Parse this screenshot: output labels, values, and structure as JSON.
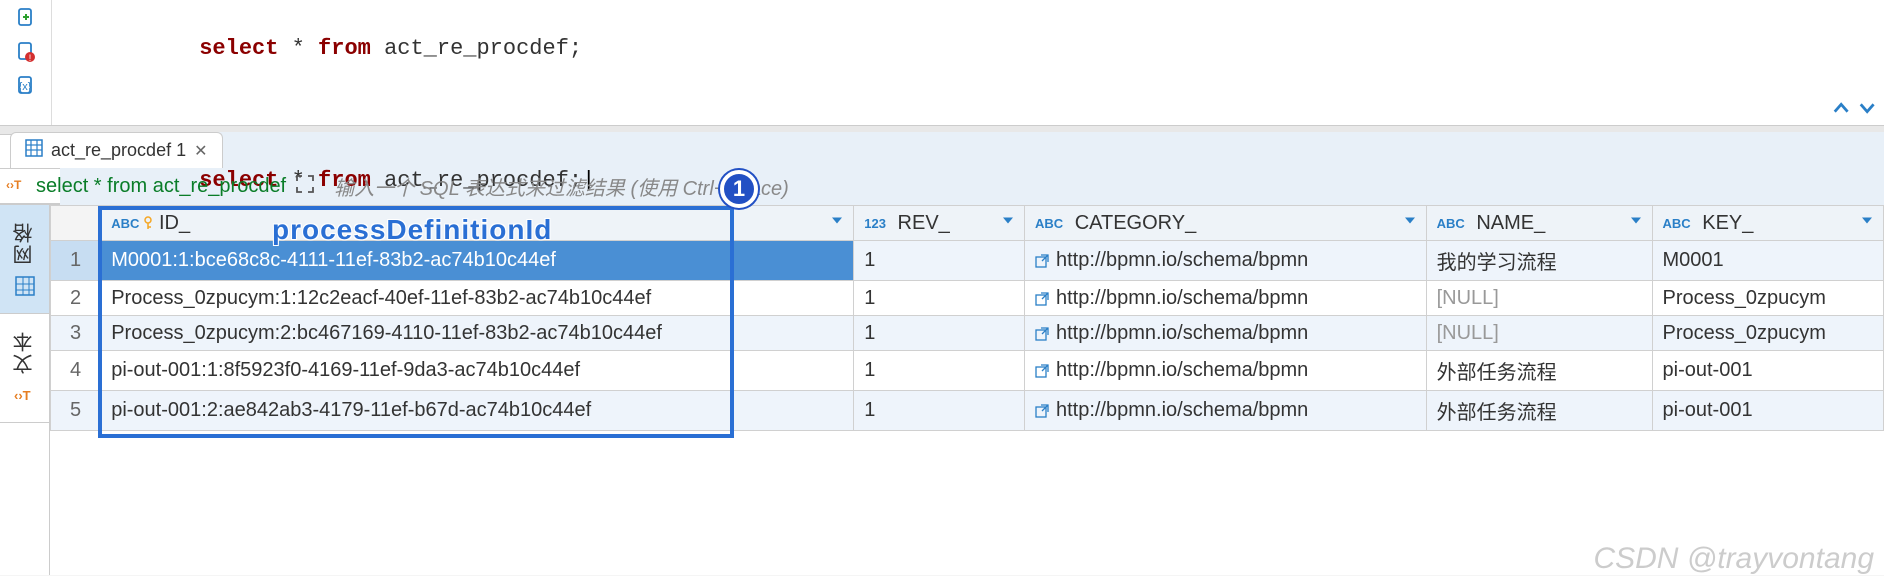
{
  "editor": {
    "line1": {
      "select": "select",
      "star": "*",
      "from": "from",
      "table": "act_re_procdef",
      "semi": ";"
    },
    "line3": {
      "select": "select",
      "star": "*",
      "from": "from",
      "table": "act_re_procdef",
      "semi": ";"
    }
  },
  "tabs": {
    "result_tab": "act_re_procdef 1"
  },
  "filter": {
    "sql": "select * from act_re_procdef",
    "placeholder": "输入一个 SQL 表达式来过滤结果 (使用 Ctrl+Space)"
  },
  "side_tabs": {
    "grid": "网格",
    "text": "文本"
  },
  "columns": {
    "id": "ID_",
    "rev": "REV_",
    "category": "CATEGORY_",
    "name": "NAME_",
    "key": "KEY_"
  },
  "col_type_abc": "ABC",
  "col_type_num": "123",
  "rows": [
    {
      "num": "1",
      "id": "M0001:1:bce68c8c-4111-11ef-83b2-ac74b10c44ef",
      "rev": "1",
      "category": "http://bpmn.io/schema/bpmn",
      "name": "我的学习流程",
      "key": "M0001"
    },
    {
      "num": "2",
      "id": "Process_0zpucym:1:12c2eacf-40ef-11ef-83b2-ac74b10c44ef",
      "rev": "1",
      "category": "http://bpmn.io/schema/bpmn",
      "name": "[NULL]",
      "key": "Process_0zpucym"
    },
    {
      "num": "3",
      "id": "Process_0zpucym:2:bc467169-4110-11ef-83b2-ac74b10c44ef",
      "rev": "1",
      "category": "http://bpmn.io/schema/bpmn",
      "name": "[NULL]",
      "key": "Process_0zpucym"
    },
    {
      "num": "4",
      "id": "pi-out-001:1:8f5923f0-4169-11ef-9da3-ac74b10c44ef",
      "rev": "1",
      "category": "http://bpmn.io/schema/bpmn",
      "name": "外部任务流程",
      "key": "pi-out-001"
    },
    {
      "num": "5",
      "id": "pi-out-001:2:ae842ab3-4179-11ef-b67d-ac74b10c44ef",
      "rev": "1",
      "category": "http://bpmn.io/schema/bpmn",
      "name": "外部任务流程",
      "key": "pi-out-001"
    }
  ],
  "annotation": {
    "label": "processDefinitionId",
    "badge": "1"
  },
  "watermark": "CSDN @trayvontang"
}
